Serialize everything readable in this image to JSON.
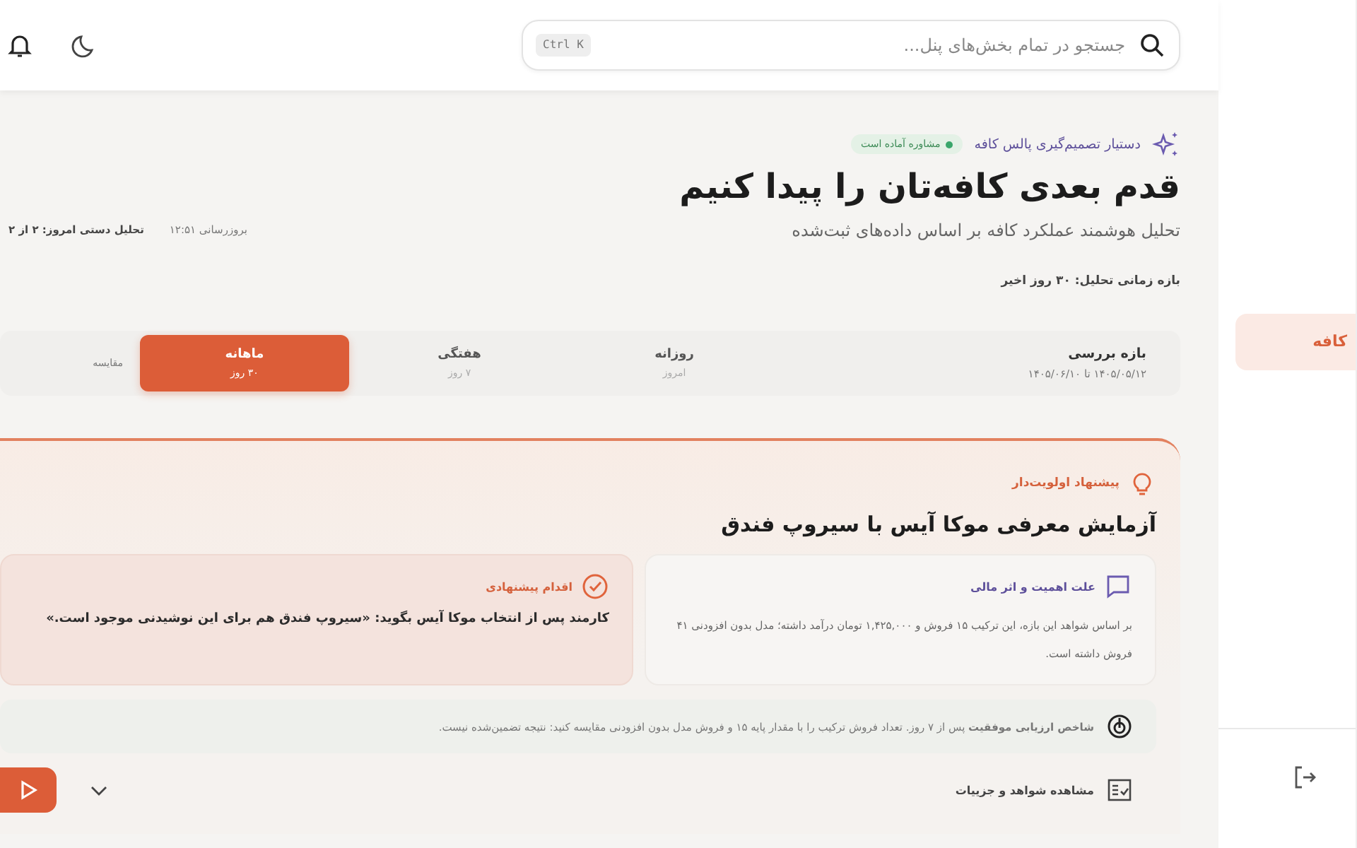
{
  "header": {
    "search": {
      "placeholder": "جستجو در تمام بخش‌های پنل...",
      "shortcut": "Ctrl K"
    }
  },
  "sidebar": {
    "items": [
      {
        "label": "کافه",
        "selected": true
      }
    ]
  },
  "hero": {
    "eyebrow": "دستیار تصمیم‌گیری پالس کافه",
    "status": {
      "label": "مشاوره آماده است",
      "color": "#3aa66b"
    },
    "title": "قدم بعدی کافه‌تان را پیدا کنیم",
    "subtitle": "تحلیل هوشمند عملکرد کافه بر اساس داده‌های ثبت‌شده",
    "updated": "بروزرسانی ۱۲:۵۱",
    "manual": "تحلیل دستی امروز: ۲ از ۲",
    "range": "بازه زمانی تحلیل: ۳۰ روز اخیر"
  },
  "period": {
    "label": "بازه بررسی",
    "dates": "۱۴۰۵/۰۵/۱۲ تا ۱۴۰۵/۰۶/۱۰",
    "tabs": [
      {
        "label": "روزانه",
        "sub": "امروز",
        "selected": false
      },
      {
        "label": "هفتگی",
        "sub": "۷ روز",
        "selected": false
      },
      {
        "label": "ماهانه",
        "sub": "۳۰ روز",
        "selected": true
      }
    ],
    "compare": "مقایسه"
  },
  "recommendation": {
    "tag": "پیشنهاد اولویت‌دار",
    "title": "آزمایش معرفی موکا آیس با سیروپ فندق",
    "reason": {
      "title": "علت اهمیت و اثر مالی",
      "text": "بر اساس شواهد این بازه، این ترکیب ۱۵ فروش و ۱,۴۲۵,۰۰۰ تومان درآمد داشته؛ مدل بدون افزودنی ۴۱ فروش داشته است."
    },
    "action": {
      "title": "اقدام پیشنهادی",
      "text": "کارمند پس از انتخاب موکا آیس بگوید: «سیروپ فندق هم برای این نوشیدنی موجود است.»"
    },
    "metric": "**شاخص ارزیابی موفقیت** پس از ۷ روز. تعداد فروش ترکیب را با مقدار پایه ۱۵ و فروش مدل بدون افزودنی مقایسه کنید: نتیجه تضمین‌شده نیست.",
    "details": "مشاهده شواهد و جزییات"
  }
}
